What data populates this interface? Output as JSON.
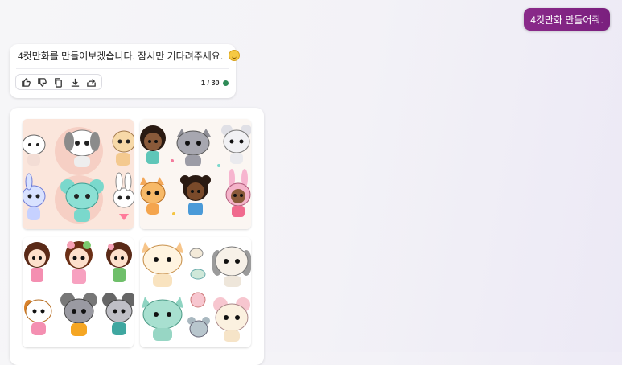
{
  "user_message": {
    "text": "4컷만화 만들어줘."
  },
  "bot_message": {
    "text": "4컷만화를 만들어보겠습니다. 잠시만 기다려주세요.",
    "emoji": "smiling-face",
    "counter": "1 / 30",
    "status_color": "#2e8b57",
    "actions": [
      "thumbs-up",
      "thumbs-down",
      "copy",
      "download",
      "share"
    ]
  },
  "images": [
    {
      "name": "image-1",
      "subject": "cartoon cats, dogs, bunnies",
      "background": "#fbe6dc"
    },
    {
      "name": "image-2",
      "subject": "cartoon girls, cats, bunny",
      "background": "#fbf6f2"
    },
    {
      "name": "image-3",
      "subject": "cartoon girls, dog, mice",
      "background": "#ffffff"
    },
    {
      "name": "image-4",
      "subject": "cartoon cat, dog, mice",
      "background": "#ffffff"
    }
  ],
  "colors": {
    "accent": "#7a1f7e"
  }
}
